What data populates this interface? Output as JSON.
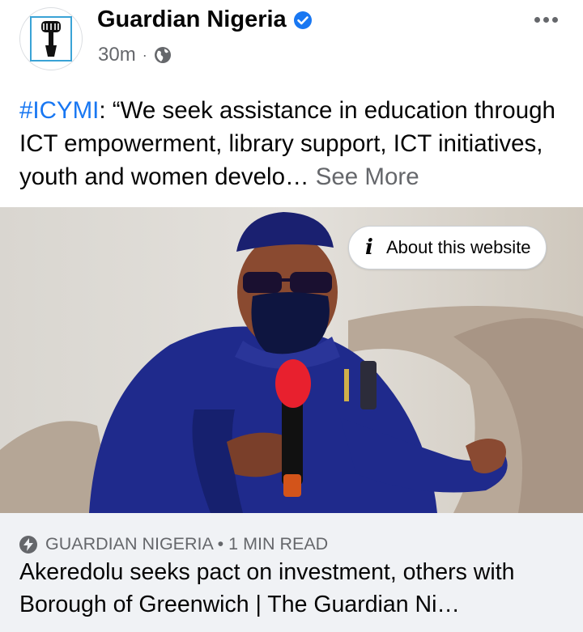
{
  "post": {
    "page_name": "Guardian Nigeria",
    "time": "30m",
    "separator": "·",
    "text_hashtag": "#ICYMI",
    "text_body": ": “We seek assistance in education through ICT empowerment, library support, ICT initiatives, youth and women develo… ",
    "see_more": "See More",
    "about_label": "About this website"
  },
  "link": {
    "source": "GUARDIAN NIGERIA • 1 MIN READ",
    "title": "Akeredolu seeks pact on investment, others with Borough of Greenwich | The Guardian Ni…"
  },
  "icons": [
    "guardian-logo-icon",
    "verified-badge-icon",
    "globe-icon",
    "more-options-icon",
    "info-icon",
    "lightning-bolt-icon"
  ],
  "colors": {
    "accent": "#1877f2",
    "secondary_text": "#65676b",
    "card_bg": "#f0f2f5"
  }
}
